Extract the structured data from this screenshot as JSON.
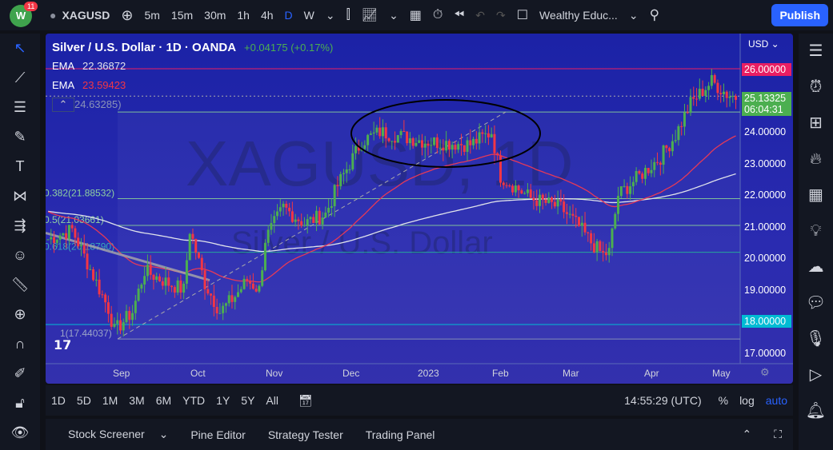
{
  "header": {
    "badge": "11",
    "symbol": "XAGUSD",
    "intervals": [
      "5m",
      "15m",
      "30m",
      "1h",
      "4h",
      "D",
      "W"
    ],
    "layout_name": "Wealthy Educ...",
    "publish": "Publish"
  },
  "legend": {
    "title": "Silver / U.S. Dollar · 1D · OANDA",
    "change": "+0.04175 (+0.17%)",
    "ema1_label": "EMA",
    "ema1_value": "22.36872",
    "ema2_label": "EMA",
    "ema2_value": "23.59423",
    "hidden_value": "24.63285)"
  },
  "watermark": {
    "line1": "XAGUSD, 1D",
    "line2": "Silver / U.S. Dollar"
  },
  "fib": [
    {
      "text": "0.382(21.88532)",
      "price": 21.885
    },
    {
      "text": "0.5(21.03661)",
      "price": 21.037
    },
    {
      "text": "0.618(20.18790)",
      "price": 20.188
    },
    {
      "text": "1(17.44037)",
      "price": 17.44
    }
  ],
  "price_axis": {
    "currency": "USD",
    "labels": [
      "24.00000",
      "23.00000",
      "22.00000",
      "21.00000",
      "20.00000",
      "19.00000",
      "17.00000"
    ],
    "ticks": [
      24,
      23,
      22,
      21,
      20,
      19,
      17
    ],
    "marker_high": "26.00000",
    "marker_last": "25.13325",
    "countdown": "06:04:31",
    "marker_support": "18.00000"
  },
  "time_axis": [
    "Sep",
    "Oct",
    "Nov",
    "Dec",
    "2023",
    "Feb",
    "Mar",
    "Apr",
    "May"
  ],
  "bottom_bar": {
    "ranges": [
      "1D",
      "5D",
      "1M",
      "3M",
      "6M",
      "YTD",
      "1Y",
      "5Y",
      "All"
    ],
    "clock": "14:55:29 (UTC)",
    "pct": "%",
    "log": "log",
    "auto": "auto"
  },
  "panel": {
    "tabs": [
      "Stock Screener",
      "Pine Editor",
      "Strategy Tester",
      "Trading Panel"
    ]
  },
  "chart_data": {
    "type": "candlestick",
    "ylim": [
      16.7,
      26.8
    ],
    "keypoints": [
      [
        0,
        20.6
      ],
      [
        8,
        20.9
      ],
      [
        20,
        18.4
      ],
      [
        22,
        17.7
      ],
      [
        28,
        18.3
      ],
      [
        32,
        19.6
      ],
      [
        40,
        19.2
      ],
      [
        45,
        19.0
      ],
      [
        47,
        20.9
      ],
      [
        52,
        19.2
      ],
      [
        57,
        18.3
      ],
      [
        62,
        18.8
      ],
      [
        66,
        19.3
      ],
      [
        70,
        19.0
      ],
      [
        72,
        20.6
      ],
      [
        78,
        21.6
      ],
      [
        85,
        21.1
      ],
      [
        92,
        21.4
      ],
      [
        96,
        22.3
      ],
      [
        104,
        23.7
      ],
      [
        110,
        24.0
      ],
      [
        125,
        23.7
      ],
      [
        140,
        23.6
      ],
      [
        147,
        24.0
      ],
      [
        150,
        22.6
      ],
      [
        160,
        21.9
      ],
      [
        170,
        21.6
      ],
      [
        176,
        21.0
      ],
      [
        180,
        20.5
      ],
      [
        184,
        20.1
      ],
      [
        186,
        20.2
      ],
      [
        189,
        22.0
      ],
      [
        196,
        22.6
      ],
      [
        203,
        23.2
      ],
      [
        208,
        23.9
      ],
      [
        213,
        24.9
      ],
      [
        220,
        25.6
      ],
      [
        225,
        25.2
      ],
      [
        228,
        25.1
      ]
    ],
    "ema_fast_period": 50,
    "ema_slow_period": 200,
    "last": 25.133
  }
}
